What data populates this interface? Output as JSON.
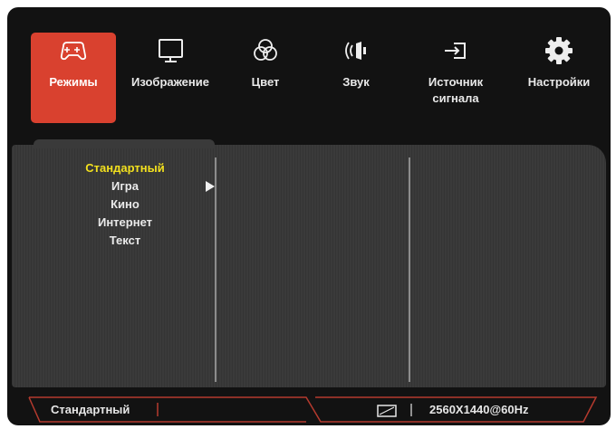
{
  "tabs": [
    {
      "label": "Режимы",
      "icon": "gamepad-icon",
      "active": true
    },
    {
      "label": "Изображение",
      "icon": "monitor-icon",
      "active": false
    },
    {
      "label": "Цвет",
      "icon": "color-circles-icon",
      "active": false
    },
    {
      "label": "Звук",
      "icon": "speaker-icon",
      "active": false
    },
    {
      "label_line1": "Источник",
      "label_line2": "сигнала",
      "icon": "input-source-icon",
      "active": false
    },
    {
      "label": "Настройки",
      "icon": "gear-icon",
      "active": false
    }
  ],
  "modes_menu": {
    "items": [
      "Стандартный",
      "Игра",
      "Кино",
      "Интернет",
      "Текст"
    ],
    "selected": "Стандартный",
    "pointer_item": "Игра"
  },
  "status_bar": {
    "mode": "Стандартный",
    "resolution": "2560X1440@60Hz",
    "aspect_icon": "aspect-ratio-icon"
  },
  "colors": {
    "accent": "#d9412f",
    "selected_text": "#f2e01e",
    "frame": "#b53a2e",
    "background": "#121212",
    "panel": "#3a3a3a"
  }
}
